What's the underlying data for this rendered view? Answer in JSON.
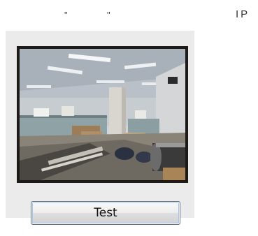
{
  "header": {
    "quote_left": "\"",
    "quote_right": "\"",
    "ip_label": "IP"
  },
  "camera": {
    "icon": "camera-preview-image"
  },
  "actions": {
    "test_label": "Test"
  }
}
